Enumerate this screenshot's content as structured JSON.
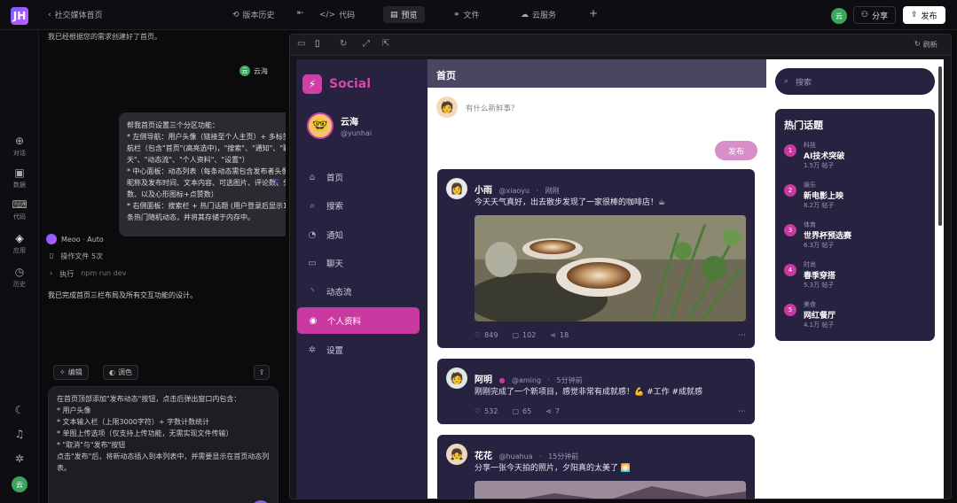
{
  "topbar": {
    "logo": "JH",
    "project_title": "社交媒体首页",
    "version_history": "版本历史",
    "tabs": [
      {
        "label": "代码"
      },
      {
        "label": "预览"
      },
      {
        "label": "文件"
      },
      {
        "label": "云服务"
      }
    ],
    "user_initials": "云",
    "share_label": "分享",
    "publish_label": "发布"
  },
  "rail": {
    "items": [
      {
        "label": "对话",
        "icon": "chat-icon"
      },
      {
        "label": "数据",
        "icon": "database-icon"
      },
      {
        "label": "代码",
        "icon": "code-icon"
      },
      {
        "label": "应用",
        "icon": "cube-icon"
      },
      {
        "label": "历史",
        "icon": "history-icon"
      }
    ],
    "bottom_avatar": "云"
  },
  "chat": {
    "top_line": "我已经根据您的需求创建好了首页。",
    "user_name": "云海",
    "user_avatar": "云",
    "bubble_text": "帮我首页设置三个分区功能：\n* 左侧导航：用户头像（链接至个人主页）+ 多标签导航栏（包含\"首页\"(高亮选中)，\"搜索\"、\"通知\"、\"聊天\"、\"动态流\"、\"个人资料\"、\"设置\"）\n* 中心面板：动态列表（每条动态需包含发布者头像、昵称及发布时间、文本内容、可选图片、评论数、分享数、以及心形图标+点赞数）\n* 右侧面板：搜索栏 + 热门话题 (用户登录后显示10条热门随机动态，并将其存储于内存中。",
    "agent_name": "Meoo · Auto",
    "step1": "操作文件 5次",
    "step2": "执行",
    "step2_detail": "npm run dev",
    "reply_line": "我已完成首页三栏布局及所有交互功能的设计。",
    "chip1": "编辑",
    "chip2": "调色",
    "compose_text": "在首页顶部添加\"发布动态\"按钮，点击后弹出窗口内包含：\n* 用户头像\n* 文本输入栏（上限3000字符）+ 字数计数统计\n* 单图上传选项（仅支持上传功能，无需实现文件传输）\n* \"取消\"与\"发布\"按钮\n点击\"发布\"后，将新动态插入到本列表中，并需要显示在首页动态列表。"
  },
  "preview_toolbar": {
    "reset_label": "刷新"
  },
  "app": {
    "brand": "Social",
    "profile": {
      "name": "云海",
      "handle": "@yunhai",
      "avatar": "🤓"
    },
    "nav": [
      {
        "label": "首页",
        "icon": "home-icon",
        "glyph": "⌂"
      },
      {
        "label": "搜索",
        "icon": "search-icon",
        "glyph": "⌕"
      },
      {
        "label": "通知",
        "icon": "bell-icon",
        "glyph": "◔"
      },
      {
        "label": "聊天",
        "icon": "message-icon",
        "glyph": "▭"
      },
      {
        "label": "动态流",
        "icon": "rss-icon",
        "glyph": "◝"
      },
      {
        "label": "个人资料",
        "icon": "user-icon",
        "glyph": "◉"
      },
      {
        "label": "设置",
        "icon": "gear-icon",
        "glyph": "✲"
      }
    ],
    "feed": {
      "title": "首页",
      "composer_placeholder": "有什么新鲜事？",
      "publish_button": "发布",
      "posts": [
        {
          "name": "小雨",
          "handle": "@xiaoyu",
          "time": "刚刚",
          "avatar": "👩",
          "text": "今天天气真好，出去散步发现了一家很棒的咖啡店！☕",
          "likes": "849",
          "comments": "102",
          "shares": "18"
        },
        {
          "name": "阿明",
          "handle": "@aming",
          "time": "5分钟前",
          "avatar": "🧑",
          "text": "刚刚完成了一个新项目，感觉非常有成就感！💪 #工作 #成就感",
          "likes": "532",
          "comments": "65",
          "shares": "7"
        },
        {
          "name": "花花",
          "handle": "@huahua",
          "time": "15分钟前",
          "avatar": "👧",
          "text": "分享一张今天拍的照片，夕阳真的太美了 🌅",
          "likes": "",
          "comments": "",
          "shares": ""
        }
      ]
    },
    "right": {
      "search_placeholder": "搜索",
      "trends_title": "热门话题",
      "trends": [
        {
          "rank": "1",
          "category": "科技",
          "name": "AI技术突破",
          "count": "1.5万 帖子"
        },
        {
          "rank": "2",
          "category": "娱乐",
          "name": "新电影上映",
          "count": "8.2万 帖子"
        },
        {
          "rank": "3",
          "category": "体育",
          "name": "世界杯预选赛",
          "count": "6.3万 帖子"
        },
        {
          "rank": "4",
          "category": "时尚",
          "name": "春季穿搭",
          "count": "5.3万 帖子"
        },
        {
          "rank": "5",
          "category": "美食",
          "name": "网红餐厅",
          "count": "4.1万 帖子"
        }
      ]
    }
  },
  "colors": {
    "accent": "#c93aa0",
    "sidebar_bg": "#26223f",
    "header_bg": "#4a4560"
  }
}
